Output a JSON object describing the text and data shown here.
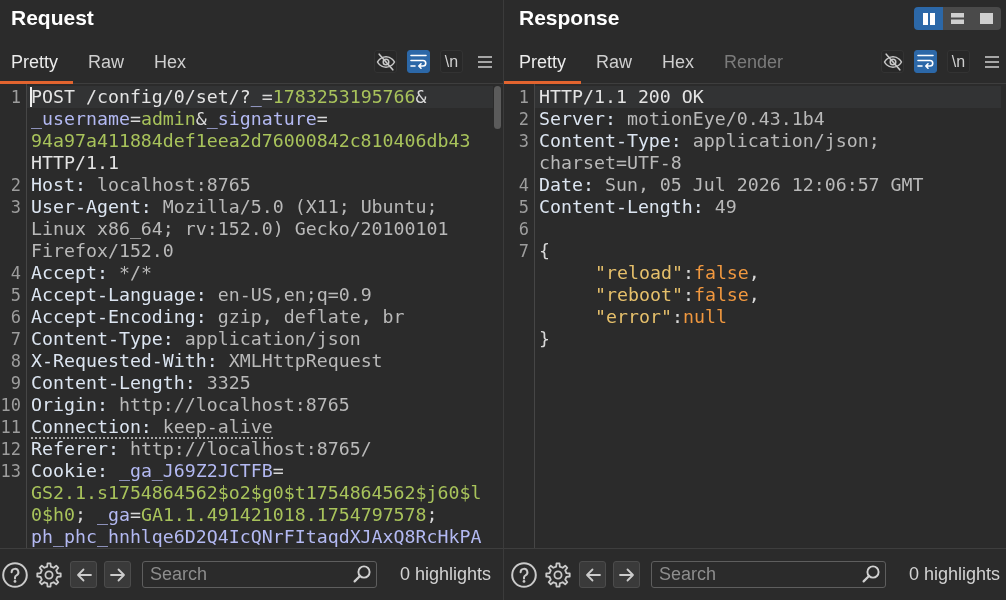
{
  "panels": [
    {
      "kind": "request",
      "title": "Request",
      "tabs": [
        {
          "label": "Pretty",
          "selected": true,
          "disabled": false
        },
        {
          "label": "Raw",
          "selected": false,
          "disabled": false
        },
        {
          "label": "Hex",
          "selected": false,
          "disabled": false
        }
      ],
      "tools": [
        {
          "kind": "visibility",
          "selected": false
        },
        {
          "kind": "wrap",
          "selected": true
        },
        {
          "kind": "newline",
          "label": "\\n",
          "selected": false
        },
        {
          "kind": "menu"
        }
      ],
      "scrollable": true,
      "lines": [
        {
          "number": "1",
          "current": true,
          "caret": true,
          "flagged": false,
          "rows": [
            {
              "tokens": [
                {
                  "kind": "plain",
                  "text": "POST /config/0/set/?"
                },
                {
                  "kind": "param",
                  "text": "_"
                },
                {
                  "kind": "punct",
                  "text": "="
                },
                {
                  "kind": "arg",
                  "text": "1783253195766"
                },
                {
                  "kind": "punct",
                  "text": "&"
                }
              ]
            },
            {
              "tokens": [
                {
                  "kind": "param",
                  "text": "_username"
                },
                {
                  "kind": "punct",
                  "text": "="
                },
                {
                  "kind": "arg",
                  "text": "admin"
                },
                {
                  "kind": "punct",
                  "text": "&"
                },
                {
                  "kind": "param",
                  "text": "_signature"
                },
                {
                  "kind": "punct",
                  "text": "="
                }
              ]
            },
            {
              "tokens": [
                {
                  "kind": "arg",
                  "text": "94a97a411884def1eea2d76000842c810406db43"
                }
              ]
            },
            {
              "tokens": [
                {
                  "kind": "plain",
                  "text": "HTTP/1.1"
                }
              ]
            }
          ]
        },
        {
          "number": "2",
          "current": false,
          "caret": false,
          "flagged": false,
          "rows": [
            {
              "tokens": [
                {
                  "kind": "name",
                  "text": "Host:"
                },
                {
                  "kind": "value",
                  "text": " localhost:8765"
                }
              ]
            }
          ]
        },
        {
          "number": "3",
          "current": false,
          "caret": false,
          "flagged": false,
          "rows": [
            {
              "tokens": [
                {
                  "kind": "name",
                  "text": "User-Agent:"
                },
                {
                  "kind": "value",
                  "text": " Mozilla/5.0 (X11; Ubuntu;"
                }
              ]
            },
            {
              "tokens": [
                {
                  "kind": "value",
                  "text": "Linux x86_64; rv:152.0) Gecko/20100101"
                }
              ]
            },
            {
              "tokens": [
                {
                  "kind": "value",
                  "text": "Firefox/152.0"
                }
              ]
            }
          ]
        },
        {
          "number": "4",
          "current": false,
          "caret": false,
          "flagged": false,
          "rows": [
            {
              "tokens": [
                {
                  "kind": "name",
                  "text": "Accept:"
                },
                {
                  "kind": "value",
                  "text": " */*"
                }
              ]
            }
          ]
        },
        {
          "number": "5",
          "current": false,
          "caret": false,
          "flagged": false,
          "rows": [
            {
              "tokens": [
                {
                  "kind": "name",
                  "text": "Accept-Language:"
                },
                {
                  "kind": "value",
                  "text": " en-US,en;q=0.9"
                }
              ]
            }
          ]
        },
        {
          "number": "6",
          "current": false,
          "caret": false,
          "flagged": false,
          "rows": [
            {
              "tokens": [
                {
                  "kind": "name",
                  "text": "Accept-Encoding:"
                },
                {
                  "kind": "value",
                  "text": " gzip, deflate, br"
                }
              ]
            }
          ]
        },
        {
          "number": "7",
          "current": false,
          "caret": false,
          "flagged": false,
          "rows": [
            {
              "tokens": [
                {
                  "kind": "name",
                  "text": "Content-Type:"
                },
                {
                  "kind": "value",
                  "text": " application/json"
                }
              ]
            }
          ]
        },
        {
          "number": "8",
          "current": false,
          "caret": false,
          "flagged": false,
          "rows": [
            {
              "tokens": [
                {
                  "kind": "name",
                  "text": "X-Requested-With:"
                },
                {
                  "kind": "value",
                  "text": " XMLHttpRequest"
                }
              ]
            }
          ]
        },
        {
          "number": "9",
          "current": false,
          "caret": false,
          "flagged": false,
          "rows": [
            {
              "tokens": [
                {
                  "kind": "name",
                  "text": "Content-Length:"
                },
                {
                  "kind": "value",
                  "text": " 3325"
                }
              ]
            }
          ]
        },
        {
          "number": "10",
          "current": false,
          "caret": false,
          "flagged": false,
          "rows": [
            {
              "tokens": [
                {
                  "kind": "name",
                  "text": "Origin:"
                },
                {
                  "kind": "value",
                  "text": " http://localhost:8765"
                }
              ]
            }
          ]
        },
        {
          "number": "11",
          "current": false,
          "caret": false,
          "flagged": true,
          "rows": [
            {
              "tokens": [
                {
                  "kind": "name",
                  "text": "Connection:"
                },
                {
                  "kind": "value",
                  "text": " keep-alive"
                }
              ]
            }
          ]
        },
        {
          "number": "12",
          "current": false,
          "caret": false,
          "flagged": false,
          "rows": [
            {
              "tokens": [
                {
                  "kind": "name",
                  "text": "Referer:"
                },
                {
                  "kind": "value",
                  "text": " http://localhost:8765/"
                }
              ]
            }
          ]
        },
        {
          "number": "13",
          "current": false,
          "caret": false,
          "flagged": false,
          "rows": [
            {
              "tokens": [
                {
                  "kind": "name",
                  "text": "Cookie:"
                },
                {
                  "kind": "param",
                  "text": " _ga_J69Z2JCTFB"
                },
                {
                  "kind": "punct",
                  "text": "="
                }
              ]
            },
            {
              "tokens": [
                {
                  "kind": "arg",
                  "text": "GS2.1.s1754864562$o2$g0$t1754864562$j60$l"
                }
              ]
            },
            {
              "tokens": [
                {
                  "kind": "arg",
                  "text": "0$h0"
                },
                {
                  "kind": "punct",
                  "text": "; "
                },
                {
                  "kind": "param",
                  "text": "_ga"
                },
                {
                  "kind": "punct",
                  "text": "="
                },
                {
                  "kind": "arg",
                  "text": "GA1.1.491421018.1754797578"
                },
                {
                  "kind": "punct",
                  "text": ";"
                }
              ]
            },
            {
              "tokens": [
                {
                  "kind": "param",
                  "text": "ph_phc_hnhlqe6D2Q4IcQNrFItaqdXJAxQ8RcHkPA"
                }
              ]
            }
          ]
        }
      ],
      "footer": {
        "search": {
          "placeholder": "Search"
        },
        "highlights": "0 highlights"
      }
    },
    {
      "kind": "response",
      "title": "Response",
      "layout_toggles": [
        {
          "kind": "columns",
          "selected": true
        },
        {
          "kind": "rows",
          "selected": false
        },
        {
          "kind": "single",
          "selected": false
        }
      ],
      "tabs": [
        {
          "label": "Pretty",
          "selected": true,
          "disabled": false
        },
        {
          "label": "Raw",
          "selected": false,
          "disabled": false
        },
        {
          "label": "Hex",
          "selected": false,
          "disabled": false
        },
        {
          "label": "Render",
          "selected": false,
          "disabled": true
        }
      ],
      "tools": [
        {
          "kind": "visibility",
          "selected": false
        },
        {
          "kind": "wrap",
          "selected": true
        },
        {
          "kind": "newline",
          "label": "\\n",
          "selected": false
        },
        {
          "kind": "menu"
        }
      ],
      "lines": [
        {
          "number": "1",
          "current": true,
          "caret": false,
          "flagged": false,
          "rows": [
            {
              "tokens": [
                {
                  "kind": "plain",
                  "text": "HTTP/1.1 200 OK"
                }
              ]
            }
          ]
        },
        {
          "number": "2",
          "current": false,
          "caret": false,
          "flagged": false,
          "rows": [
            {
              "tokens": [
                {
                  "kind": "name",
                  "text": "Server:"
                },
                {
                  "kind": "value",
                  "text": " motionEye/0.43.1b4"
                }
              ]
            }
          ]
        },
        {
          "number": "3",
          "current": false,
          "caret": false,
          "flagged": false,
          "rows": [
            {
              "tokens": [
                {
                  "kind": "name",
                  "text": "Content-Type:"
                },
                {
                  "kind": "value",
                  "text": " application/json;"
                }
              ]
            },
            {
              "tokens": [
                {
                  "kind": "value",
                  "text": "charset=UTF-8"
                }
              ]
            }
          ]
        },
        {
          "number": "4",
          "current": false,
          "caret": false,
          "flagged": false,
          "rows": [
            {
              "tokens": [
                {
                  "kind": "name",
                  "text": "Date:"
                },
                {
                  "kind": "value",
                  "text": " Sun, 05 Jul 2026 12:06:57 GMT"
                }
              ]
            }
          ]
        },
        {
          "number": "5",
          "current": false,
          "caret": false,
          "flagged": false,
          "rows": [
            {
              "tokens": [
                {
                  "kind": "name",
                  "text": "Content-Length:"
                },
                {
                  "kind": "value",
                  "text": " 49"
                }
              ]
            }
          ]
        },
        {
          "number": "6",
          "current": false,
          "caret": false
        },
        {
          "number": "7",
          "current": false,
          "caret": false,
          "flagged": false,
          "rows": [
            {
              "tokens": [
                {
                  "kind": "punct",
                  "text": "{"
                }
              ],
              "children": [
                {
                  "tokens": [
                    {
                      "kind": "key",
                      "text": "\"reload\""
                    },
                    {
                      "kind": "punct",
                      "text": ":"
                    },
                    {
                      "kind": "literal",
                      "text": "false"
                    },
                    {
                      "kind": "punct",
                      "text": ","
                    }
                  ]
                },
                {
                  "tokens": [
                    {
                      "kind": "key",
                      "text": "\"reboot\""
                    },
                    {
                      "kind": "punct",
                      "text": ":"
                    },
                    {
                      "kind": "literal",
                      "text": "false"
                    },
                    {
                      "kind": "punct",
                      "text": ","
                    }
                  ]
                },
                {
                  "tokens": [
                    {
                      "kind": "key",
                      "text": "\"error\""
                    },
                    {
                      "kind": "punct",
                      "text": ":"
                    },
                    {
                      "kind": "literal",
                      "text": "null"
                    }
                  ]
                }
              ]
            },
            {
              "tokens": [
                {
                  "kind": "punct",
                  "text": "}"
                }
              ]
            }
          ]
        }
      ],
      "footer": {
        "search": {
          "placeholder": "Search"
        },
        "highlights": "0 highlights"
      }
    }
  ]
}
